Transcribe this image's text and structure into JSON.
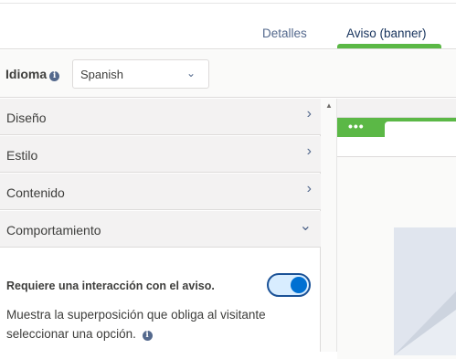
{
  "tabs": [
    {
      "label": "Detalles"
    },
    {
      "label": "Aviso (banner)"
    }
  ],
  "active_tab_color": "#5bb846",
  "language": {
    "label": "Idioma",
    "selected": "Spanish"
  },
  "accordion": [
    {
      "label": "Diseño"
    },
    {
      "label": "Estilo"
    },
    {
      "label": "Contenido"
    },
    {
      "label": "Comportamiento"
    }
  ],
  "behavior": {
    "title": "Requiere una interacción con el aviso.",
    "description_line1": "Muestra la superposición que obliga al visitante",
    "description_line2": "seleccionar una opción.",
    "toggle_on": true
  },
  "icons": {
    "info": "info-icon",
    "chevron_right": "chevron-right-icon",
    "chevron_down": "chevron-down-icon"
  }
}
